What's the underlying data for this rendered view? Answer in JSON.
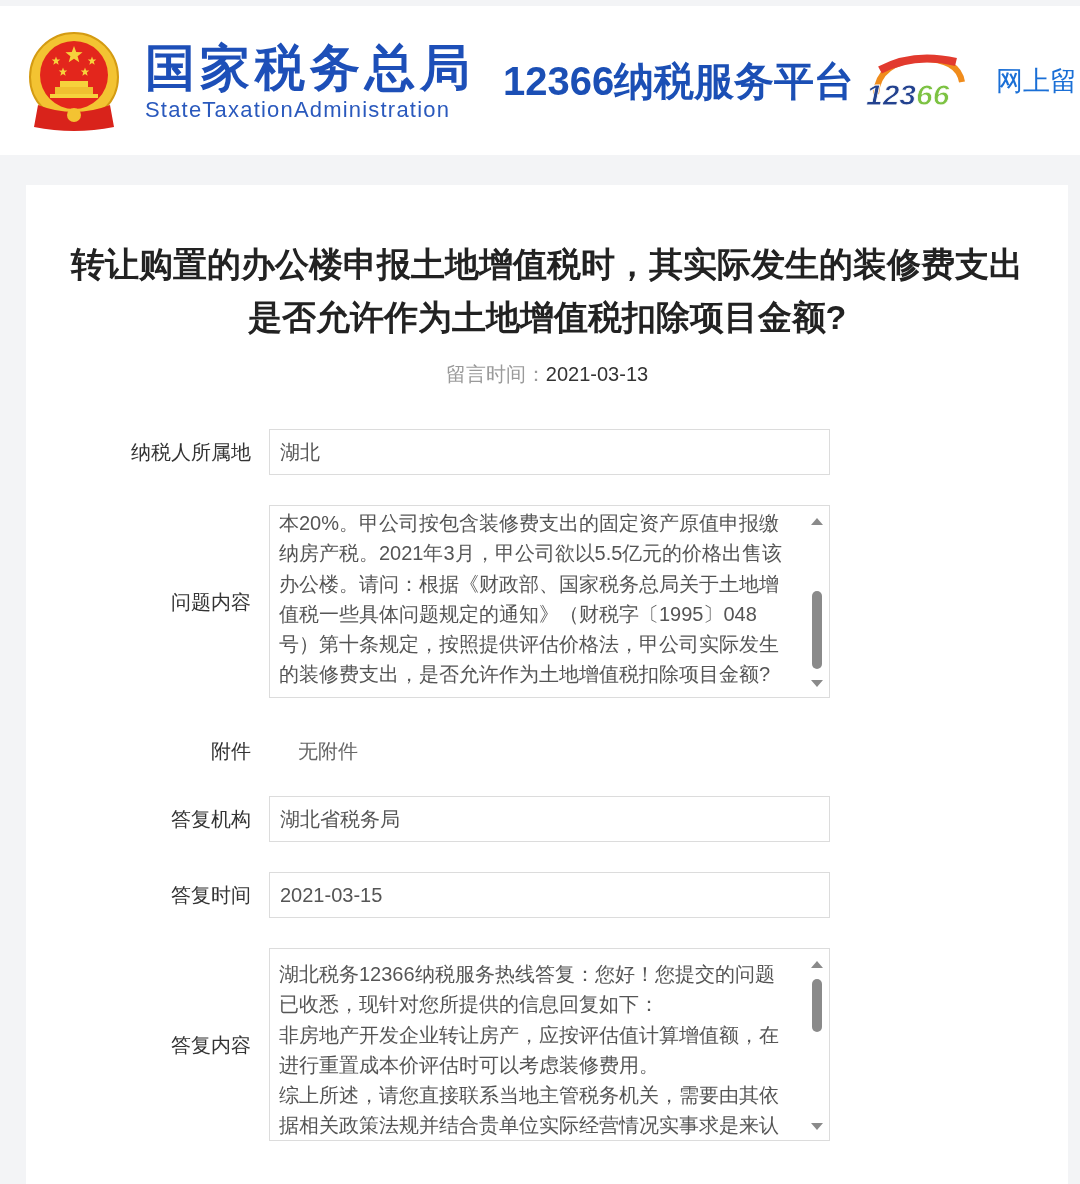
{
  "header": {
    "agency_name": "国家税务总局",
    "agency_name_en": "StateTaxationAdministration",
    "platform_name": "12366纳税服务平台",
    "platform_logo_text": "12366",
    "nav_link": "网上留"
  },
  "message": {
    "title": "转让购置的办公楼申报土地增值税时，其实际发生的装修费支出是否允许作为土地增值税扣除项目金额?",
    "meta_label": "留言时间：",
    "meta_value": "2021-03-13",
    "fields": [
      {
        "kind": "input",
        "label": "纳税人所属地",
        "value": "湖北"
      },
      {
        "kind": "textarea",
        "label": "问题内容",
        "lines": [
          "本20%。甲公司按包含装修费支出的固定资产原值申报缴",
          "纳房产税。2021年3月，甲公司欲以5.5亿元的价格出售该",
          "办公楼。请问：根据《财政部、国家税务总局关于土地增",
          "值税一些具体问题规定的通知》（财税字〔1995〕048",
          "号）第十条规定，按照提供评估价格法，甲公司实际发生",
          "的装修费支出，是否允许作为土地增值税扣除项目金额?"
        ]
      },
      {
        "kind": "plain",
        "label": "附件",
        "value": "无附件"
      },
      {
        "kind": "input",
        "label": "答复机构",
        "value": "湖北省税务局"
      },
      {
        "kind": "input",
        "label": "答复时间",
        "value": "2021-03-15"
      },
      {
        "kind": "textarea",
        "label": "答复内容",
        "lines": [
          "湖北税务12366纳税服务热线答复：您好！您提交的问题",
          "已收悉，现针对您所提供的信息回复如下：",
          "非房地产开发企业转让房产，应按评估值计算增值额，在",
          "进行重置成本价评估时可以考虑装修费用。",
          "综上所述，请您直接联系当地主管税务机关，需要由其依",
          "据相关政策法规并结合贵单位实际经营情况实事求是来认"
        ]
      }
    ]
  }
}
